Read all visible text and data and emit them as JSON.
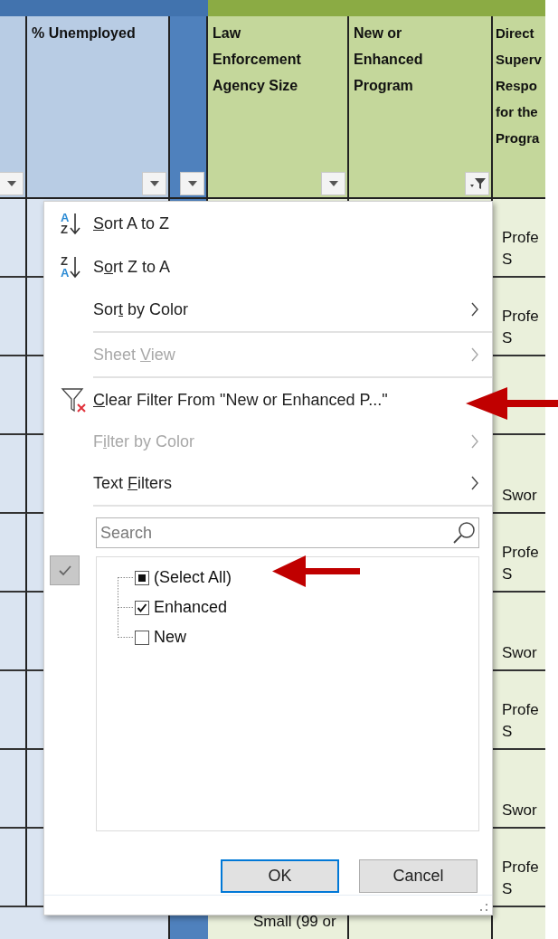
{
  "sheet": {
    "columns": [
      {
        "color": "#b8cce4",
        "filtered": false
      },
      {
        "header": [
          "% Unemployed"
        ],
        "color": "#b8cce4",
        "filtered": false
      },
      {
        "color": "#4f81bd",
        "filtered": false
      },
      {
        "header": [
          "Law",
          "Enforcement",
          "Agency Size"
        ],
        "color": "#c4d79b",
        "filtered": false
      },
      {
        "header": [
          "New or",
          "Enhanced",
          "Program"
        ],
        "color": "#c4d79b",
        "filtered": true
      },
      {
        "header": [
          "Direct",
          "Superv",
          "Respo",
          "for the",
          "Progra"
        ],
        "color": "#c4d79b"
      }
    ],
    "rows": [
      {
        "column_6": [
          "Profe",
          "S"
        ]
      },
      {
        "column_6": [
          "Profe",
          "S"
        ]
      },
      {},
      {
        "column_6": [
          "Swor"
        ]
      },
      {
        "column_6": [
          "Profe",
          "S"
        ]
      },
      {
        "column_6": [
          "Swor"
        ]
      },
      {
        "column_6": [
          "Profe",
          "S"
        ]
      },
      {
        "column_6": [
          "Swor"
        ]
      },
      {
        "column_6": [
          "Profe",
          "S"
        ]
      },
      {
        "column_4": [
          "Small (99 or"
        ]
      }
    ]
  },
  "filter_menu": {
    "items": [
      {
        "kind": "sort_ascending",
        "icon_top": "A",
        "icon_bottom": "Z",
        "access_key": "S",
        "label_after": "ort A to Z",
        "disabled": false
      },
      {
        "kind": "sort_descending",
        "icon_top": "Z",
        "icon_bottom": "A",
        "label_before": "S",
        "access_key": "o",
        "label_after": "rt Z to A",
        "disabled": false
      },
      {
        "kind": "submenu",
        "label_before": "Sor",
        "access_key": "t",
        "label_after": " by Color",
        "disabled": false
      },
      {
        "kind": "separator"
      },
      {
        "kind": "submenu",
        "label_before": "Sheet ",
        "access_key": "V",
        "label_after": "iew",
        "disabled": true
      },
      {
        "kind": "separator"
      },
      {
        "kind": "clear_filter",
        "access_key": "C",
        "label_after": "lear Filter From \"New or Enhanced P...\"",
        "disabled": false
      },
      {
        "kind": "submenu",
        "label_before": "F",
        "access_key": "i",
        "label_after": "lter by Color",
        "disabled": true
      },
      {
        "kind": "submenu",
        "label_before": "Text ",
        "access_key": "F",
        "label_after": "ilters",
        "disabled": false
      },
      {
        "kind": "separator"
      }
    ],
    "search": {
      "placeholder": "Search"
    },
    "values": [
      {
        "label": "(Select All)",
        "checked": false,
        "mixed": true
      },
      {
        "label": "Enhanced",
        "checked": true,
        "mixed": false
      },
      {
        "label": "New",
        "checked": false,
        "mixed": false
      }
    ],
    "buttons": [
      {
        "label": "OK",
        "focused": true
      },
      {
        "label": "Cancel",
        "focused": false
      }
    ]
  }
}
